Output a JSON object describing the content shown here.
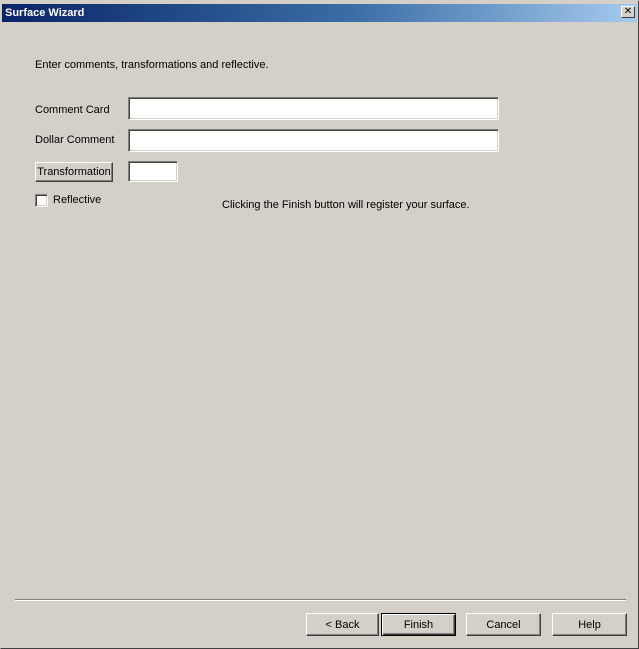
{
  "window": {
    "title": "Surface Wizard",
    "close_glyph": "✕"
  },
  "main": {
    "instruction": "Enter comments, transformations and reflective.",
    "comment_card": {
      "label": "Comment Card",
      "value": ""
    },
    "dollar_comment": {
      "label": "Dollar Comment",
      "value": ""
    },
    "transformation": {
      "button_label": "Transformation",
      "value": ""
    },
    "reflective": {
      "label": "Reflective",
      "checked": false
    },
    "finish_note": "Clicking the Finish button will register your surface."
  },
  "footer": {
    "back_label": "< Back",
    "finish_label": "Finish",
    "cancel_label": "Cancel",
    "help_label": "Help"
  }
}
